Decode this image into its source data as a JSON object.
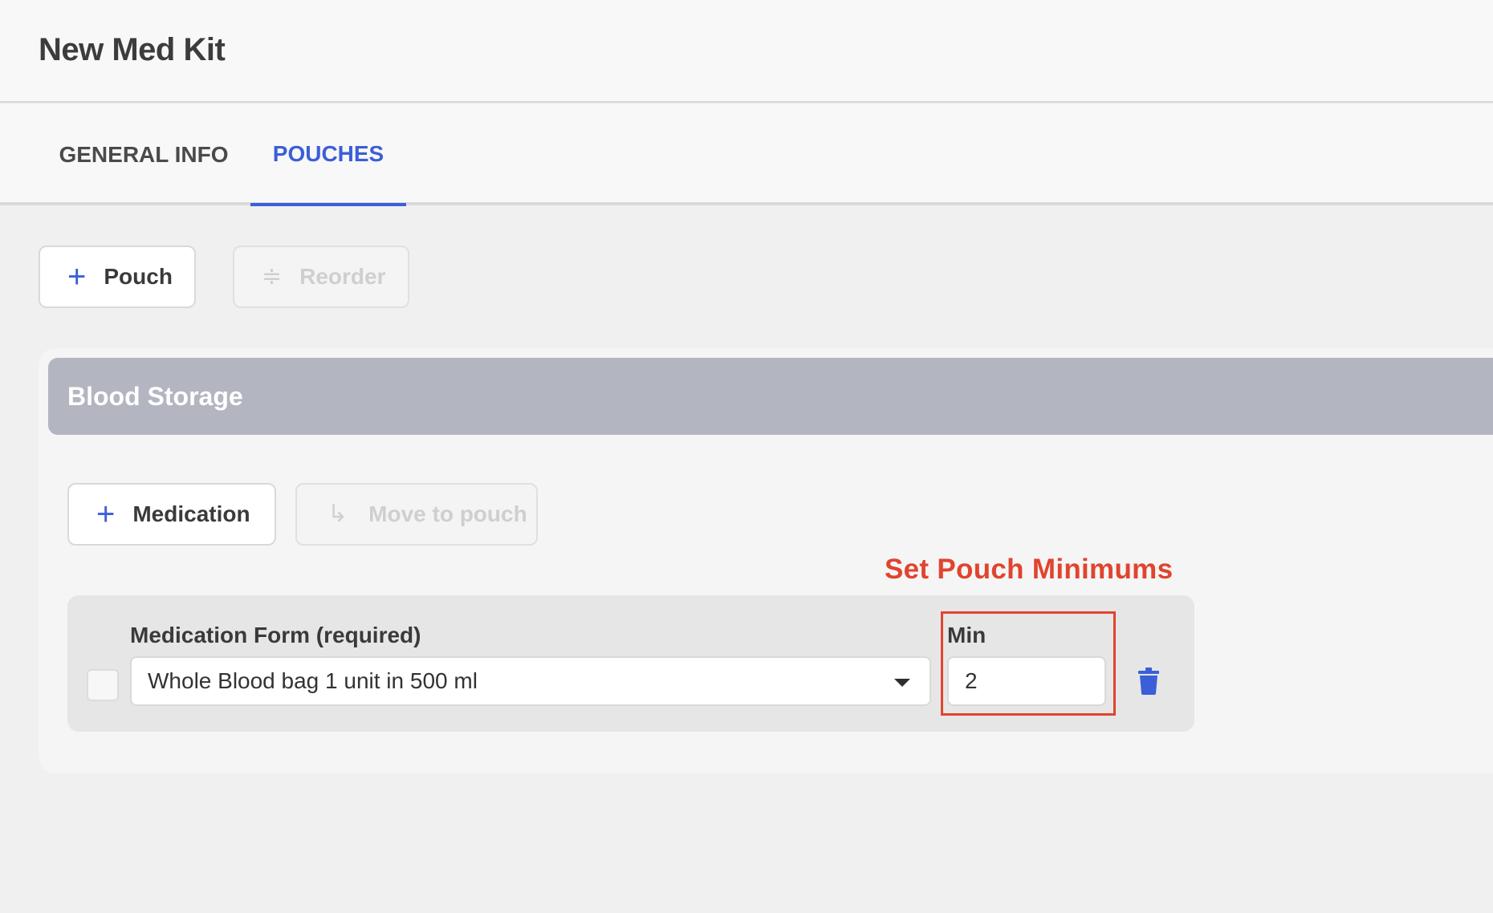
{
  "header": {
    "title": "New Med Kit"
  },
  "tabs": [
    {
      "label": "GENERAL INFO",
      "active": false
    },
    {
      "label": "POUCHES",
      "active": true
    }
  ],
  "toolbar": {
    "add_pouch_label": "Pouch",
    "add_pouch_icon": "plus-icon",
    "reorder_label": "Reorder",
    "reorder_icon": "reorder-icon"
  },
  "pouch": {
    "title": "Blood Storage",
    "add_medication_label": "Medication",
    "add_medication_icon": "plus-icon",
    "move_to_pouch_label": "Move to pouch",
    "move_to_pouch_icon": "arrow-return-icon",
    "medications": [
      {
        "form_label": "Medication Form (required)",
        "form_value": "Whole Blood bag 1 unit in 500 ml",
        "min_label": "Min",
        "min_value": "2",
        "checked": false,
        "delete_icon": "trash-icon"
      }
    ]
  },
  "annotation": {
    "text": "Set Pouch Minimums",
    "color": "#e0442f"
  },
  "colors": {
    "accent": "#3b5fd8",
    "pouch_header": "#b3b5c0",
    "annotation": "#e0442f"
  }
}
